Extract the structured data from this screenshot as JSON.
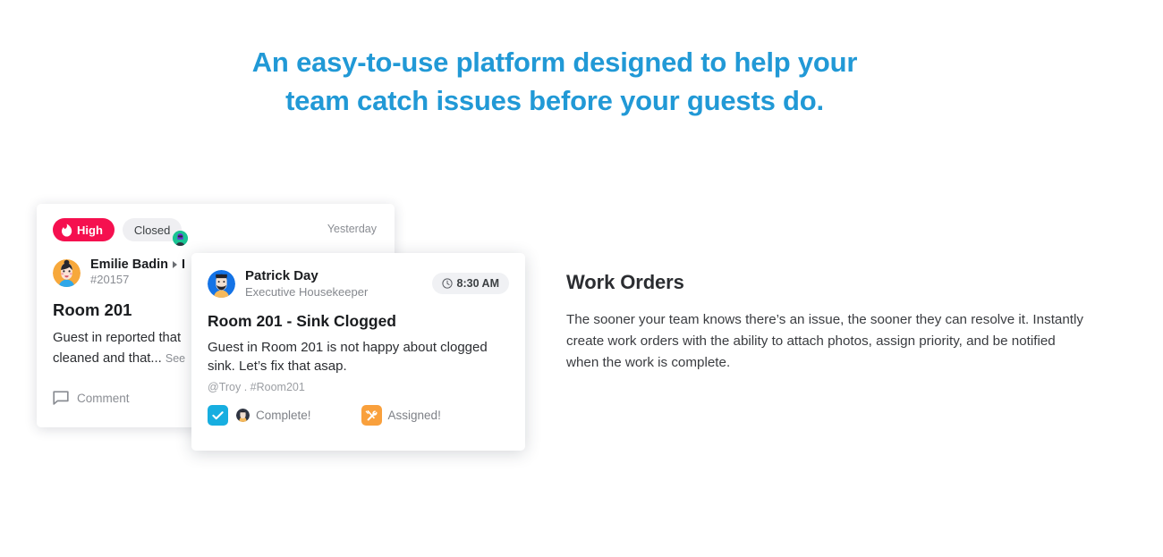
{
  "headline": {
    "line1": "An easy-to-use platform designed to help your",
    "line2": "team catch issues before your guests do.",
    "color": "#2199D6"
  },
  "back_card": {
    "priority_badge": "High",
    "priority_icon": "flame-icon",
    "priority_color": "#F5104F",
    "status_badge": "Closed",
    "timestamp": "Yesterday",
    "user_name": "Emilie Badin",
    "ticket_id": "#20157",
    "title": "Room 201",
    "body_line1": "Guest in reported that",
    "body_line2": "cleaned and that...",
    "see_more": "See",
    "comment_label": "Comment",
    "comment_icon": "speech-bubble-icon"
  },
  "front_card": {
    "user_name": "Patrick Day",
    "user_role": "Executive Housekeeper",
    "time": "8:30 AM",
    "time_icon": "clock-icon",
    "title": "Room 201 - Sink Clogged",
    "body": "Guest in Room 201 is not happy about clogged sink. Let’s fix that asap.",
    "tags": "@Troy . #Room201",
    "actions": [
      {
        "icon": "checkbox-checked-icon",
        "icon_color": "#17AEE0",
        "label": "Complete!",
        "has_avatar": true
      },
      {
        "icon": "tools-icon",
        "icon_color": "#F9A03C",
        "label": "Assigned!",
        "has_avatar": false
      }
    ]
  },
  "feature": {
    "title": "Work Orders",
    "description": "The sooner your team knows there’s an issue, the sooner they can resolve it. Instantly create work orders with the ability to attach photos, assign priority, and be notified when the work is complete."
  }
}
